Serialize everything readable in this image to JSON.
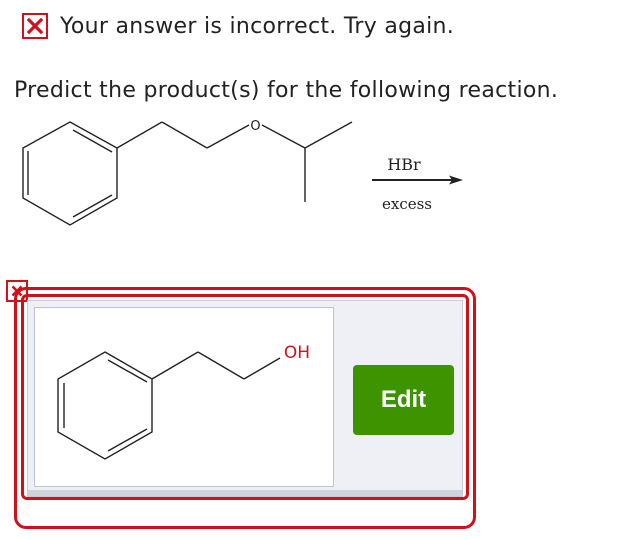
{
  "feedback": {
    "icon": "x-mark-icon",
    "text": "Your answer is incorrect.  Try again.",
    "color": "#d0101b"
  },
  "question": {
    "text": "Predict the product(s) for the following reaction."
  },
  "reaction": {
    "oxygen_label": "O",
    "reagent": "HBr",
    "condition": "excess"
  },
  "answer": {
    "product_label": "OH",
    "edit_label": "Edit",
    "edit_color": "#3d9400",
    "status_icon": "x-mark-icon"
  }
}
